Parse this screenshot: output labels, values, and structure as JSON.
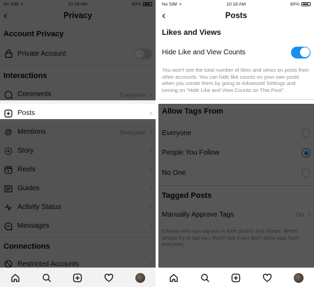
{
  "left": {
    "status": {
      "carrier": "No SIM",
      "time": "10:18 AM",
      "battery": "80%"
    },
    "title": "Privacy",
    "account_privacy": {
      "heading": "Account Privacy",
      "private_account": {
        "label": "Private Account",
        "on": false
      }
    },
    "interactions": {
      "heading": "Interactions",
      "items": [
        {
          "label": "Comments",
          "value": "Everyone",
          "icon": "comment-icon"
        },
        {
          "label": "Posts",
          "value": "",
          "icon": "plus-square-icon"
        },
        {
          "label": "Mentions",
          "value": "Everyone",
          "icon": "at-icon"
        },
        {
          "label": "Story",
          "value": "",
          "icon": "story-icon"
        },
        {
          "label": "Reels",
          "value": "",
          "icon": "reels-icon"
        },
        {
          "label": "Guides",
          "value": "",
          "icon": "guides-icon"
        },
        {
          "label": "Activity Status",
          "value": "",
          "icon": "activity-icon"
        },
        {
          "label": "Messages",
          "value": "",
          "icon": "messages-icon"
        }
      ]
    },
    "connections": {
      "heading": "Connections",
      "items": [
        {
          "label": "Restricted Accounts",
          "icon": "restricted-icon"
        }
      ]
    }
  },
  "right": {
    "status": {
      "carrier": "No SIM",
      "time": "10:18 AM",
      "battery": "80%"
    },
    "title": "Posts",
    "likes_views": {
      "heading": "Likes and Views",
      "hide_counts": {
        "label": "Hide Like and View Counts",
        "on": true
      },
      "note": "You won't see the total number of likes and views on posts from other accounts. You can hide like counts on your own posts when you create them by going to Advanced Settings and turning on \"Hide Like and View Counts on This Post\"."
    },
    "allow_tags": {
      "heading": "Allow Tags From",
      "options": [
        {
          "label": "Everyone",
          "selected": false
        },
        {
          "label": "People You Follow",
          "selected": true
        },
        {
          "label": "No One",
          "selected": false
        }
      ]
    },
    "tagged_posts": {
      "heading": "Tagged Posts",
      "manual": {
        "label": "Manually Approve Tags",
        "value": "On"
      },
      "note": "Choose who can tag you in their photos and videos. When people try to tag you, they'll see if you don't allow tags from everyone."
    }
  },
  "tabbar": [
    "home-icon",
    "search-icon",
    "create-icon",
    "activity-heart-icon",
    "profile-avatar"
  ],
  "colors": {
    "accent": "#1a8ff2",
    "dim_overlay": "rgba(0,0,0,0.66)",
    "background": "#f2f2f2"
  }
}
